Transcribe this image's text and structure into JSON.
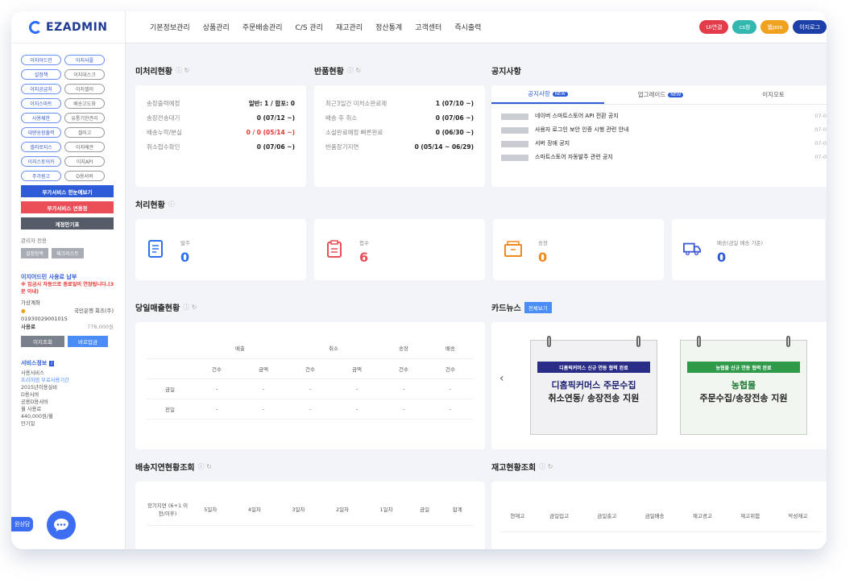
{
  "brand": {
    "logo_text": "EZADMIN"
  },
  "top_menu": [
    "기본정보관리",
    "상품관리",
    "주문배송관리",
    "C/S 관리",
    "재고관리",
    "정산통계",
    "고객센터",
    "즉시출력"
  ],
  "top_buttons": [
    {
      "label": "UI연결",
      "color": "#e33b4a"
    },
    {
      "label": "cs창",
      "color": "#33b8b0"
    },
    {
      "label": "웹pos",
      "color": "#f0a21f"
    },
    {
      "label": "이지로그",
      "color": "#1d3fa8"
    }
  ],
  "sidebar": {
    "pills": [
      "이지어드민",
      "이지샤플",
      "설정책",
      "이지데스크",
      "이지공급처",
      "이지셀러",
      "이지스마트",
      "배송고도화",
      "사용제한",
      "유통기한관리",
      "대량송장출력",
      "셀러고",
      "셀러로지스",
      "이지배관",
      "이지스토어카",
      "이지API",
      "주가원고",
      "D용서버"
    ],
    "btn_addon": "부가서비스 한눈에보기",
    "btn_apply": "부가서비스 연용정",
    "btn_account": "계정만기표",
    "admin_label": "관리자 전용",
    "admin_btns": [
      "설정항목",
      "체크리스트"
    ],
    "notice_title": "이지어드민 사용료 납부",
    "notice_sub": "※ 입금시 자동으로 충료일이 연장됩니다.(3분 이내)",
    "account_label": "가상계좌",
    "bank": "국민은행 회즈(주)",
    "account_no": "01930029001015",
    "fee_label": "사용료",
    "fee_value": "778,000원",
    "pay_btns": [
      "이지조회",
      "바로입금"
    ],
    "service_title": "서비스정보",
    "service_lines": [
      "사용서비스",
      "프리미엄 무료사용기간",
      "2015년이용설비",
      "D용서버",
      "공용D용서버",
      "월 사용료",
      "440,000원/월",
      "만기일"
    ],
    "chat_label": "원상담"
  },
  "unprocessed": {
    "title": "미처리현황",
    "rows": [
      {
        "label": "송장출력예정",
        "value": "일반: 1 / 합포: 0",
        "red": false
      },
      {
        "label": "송장전송대기",
        "value": "0 (07/12 ~)",
        "red": false
      },
      {
        "label": "배송누락/분실",
        "value": "0 / 0 (05/14 ~)",
        "red": true
      },
      {
        "label": "취소접수확인",
        "value": "0 (07/06 ~)",
        "red": false
      }
    ]
  },
  "returns": {
    "title": "반품현황",
    "rows": [
      {
        "label": "최근3일간 미처소완료제",
        "value": "1 (07/10 ~)"
      },
      {
        "label": "배송 후 취소",
        "value": "0 (07/06 ~)"
      },
      {
        "label": "소설완료예정 빠른완료",
        "value": "0 (06/30 ~)"
      },
      {
        "label": "반품장기지연",
        "value": "0 (05/14 ~ 06/29)"
      }
    ]
  },
  "notices": {
    "title": "공지사항",
    "tabs": [
      {
        "label": "공지사항",
        "new": true
      },
      {
        "label": "업그레이드",
        "new": true
      },
      {
        "label": "이지오토",
        "new": false
      }
    ],
    "items": [
      {
        "text": "네이버 스마트스토어 API 전환 공지",
        "date": "07-0"
      },
      {
        "text": "사용자 로그인 보안 인증 시행 관련 안내",
        "date": "07-0"
      },
      {
        "text": "서버 장애 공지",
        "date": "07-0"
      },
      {
        "text": "스마트스토어 자동발주 관련 공지",
        "date": "07-0"
      }
    ],
    "new_badge": "NEW"
  },
  "processing": {
    "title": "처리현황",
    "cards": [
      {
        "label": "발주",
        "value": "0",
        "color": "#2e6ff2"
      },
      {
        "label": "접수",
        "value": "6",
        "color": "#ea4e57"
      },
      {
        "label": "송장",
        "value": "0",
        "color": "#f08a1f"
      },
      {
        "label": "배송(금일 배송 기준)",
        "value": "0",
        "color": "#2e5bd8"
      }
    ]
  },
  "sales": {
    "title": "당일매출현황",
    "groups": [
      "매출",
      "취소",
      "송장",
      "배송"
    ],
    "subs": [
      "건수",
      "금액",
      "건수",
      "금액",
      "건수",
      "건수"
    ],
    "rows": [
      {
        "label": "금일",
        "cells": [
          "-",
          "-",
          "-",
          "-",
          "-",
          "-"
        ]
      },
      {
        "label": "전일",
        "cells": [
          "-",
          "-",
          "-",
          "-",
          "-",
          "-"
        ]
      }
    ]
  },
  "card_news": {
    "title": "카드뉴스",
    "all_btn": "전체보기",
    "prev": "‹",
    "cards": [
      {
        "bar": "디홈픽커머스 신규 연동 협력 완료",
        "line1": "디홈픽커머스 주문수집",
        "line2": "취소연동/ 송장전송 지원",
        "bar_color": "#2a2d86",
        "text_color": "#1c1f70"
      },
      {
        "bar": "농협몰 신규 연동 협력 완료",
        "line1": "농협몰",
        "line2": "주문수집/송장전송 지원",
        "bar_color": "#2e9a4a",
        "text_color": "#1d7a35"
      }
    ]
  },
  "delay": {
    "title": "배송지연현황조회",
    "cols": [
      "장기지연 (6+1 이전/이후)",
      "5일차",
      "4일차",
      "3일차",
      "2일차",
      "1일차",
      "금일",
      "합계"
    ]
  },
  "stock": {
    "title": "재고현황조회",
    "cols": [
      "현재고",
      "금일입고",
      "금일출고",
      "금일배송",
      "재고경고",
      "재고위험",
      "악성재고"
    ]
  }
}
